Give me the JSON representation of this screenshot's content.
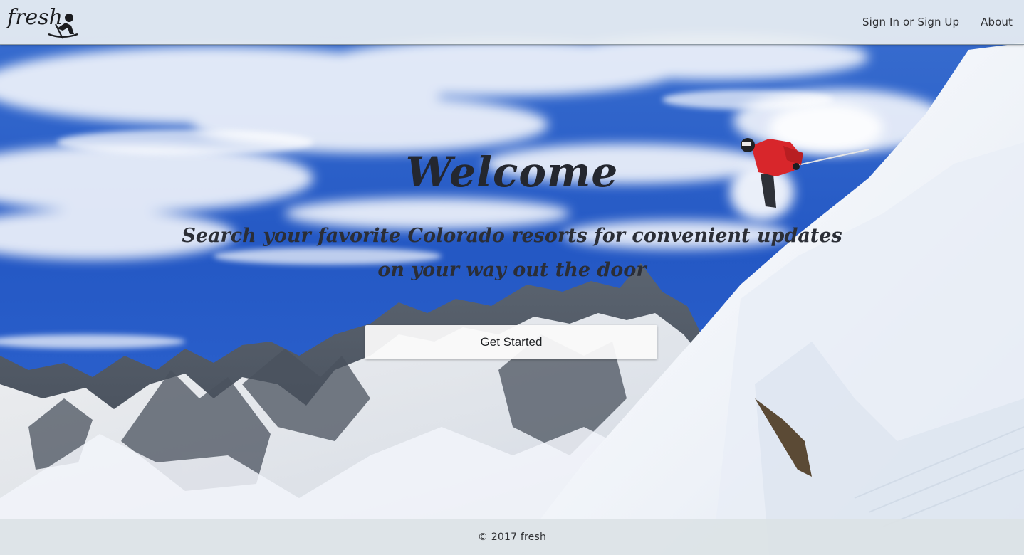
{
  "header": {
    "logo_text": "fresh",
    "nav": [
      {
        "label": "Sign In or Sign Up"
      },
      {
        "label": "About"
      }
    ]
  },
  "hero": {
    "title": "Welcome",
    "subtitle": "Search your favorite Colorado resorts for convenient updates on your way out the door",
    "cta_label": "Get Started",
    "background_image": "photo of skier descending a steep snow slope with mountain range under blue sky"
  },
  "footer": {
    "text": "© 2017 fresh"
  },
  "colors": {
    "sky": "#2d63c8",
    "snow": "#f3f6fa",
    "skier_jacket": "#d8262b",
    "text_dark": "#24272f",
    "navbar_bg": "#e8eef2"
  },
  "icons": {
    "logo": "skier-logo-icon"
  }
}
